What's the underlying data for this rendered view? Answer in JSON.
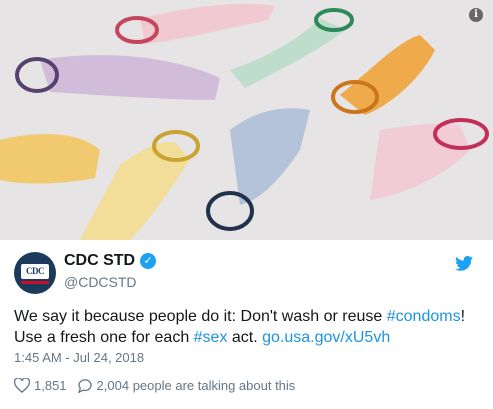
{
  "media": {
    "description_icon": "info-icon",
    "info_glyph": "i"
  },
  "author": {
    "display_name": "CDC STD",
    "handle": "@CDCSTD",
    "avatar_text": "CDC",
    "verified_icon": "verified-badge-icon"
  },
  "tweet": {
    "part1": "We say it because people do it: Don't wash or reuse ",
    "hashtag1": "#condoms",
    "part2": "! Use a fresh one for each ",
    "hashtag2": "#sex",
    "part3": " act. ",
    "link": "go.usa.gov/xU5vh"
  },
  "timestamp": "1:45 AM - Jul 24, 2018",
  "actions": {
    "likes": "1,851",
    "comments_text": "2,004 people are talking about this"
  },
  "colors": {
    "link": "#1b95e0",
    "twitter_blue": "#1da1f2",
    "muted": "#657786"
  }
}
